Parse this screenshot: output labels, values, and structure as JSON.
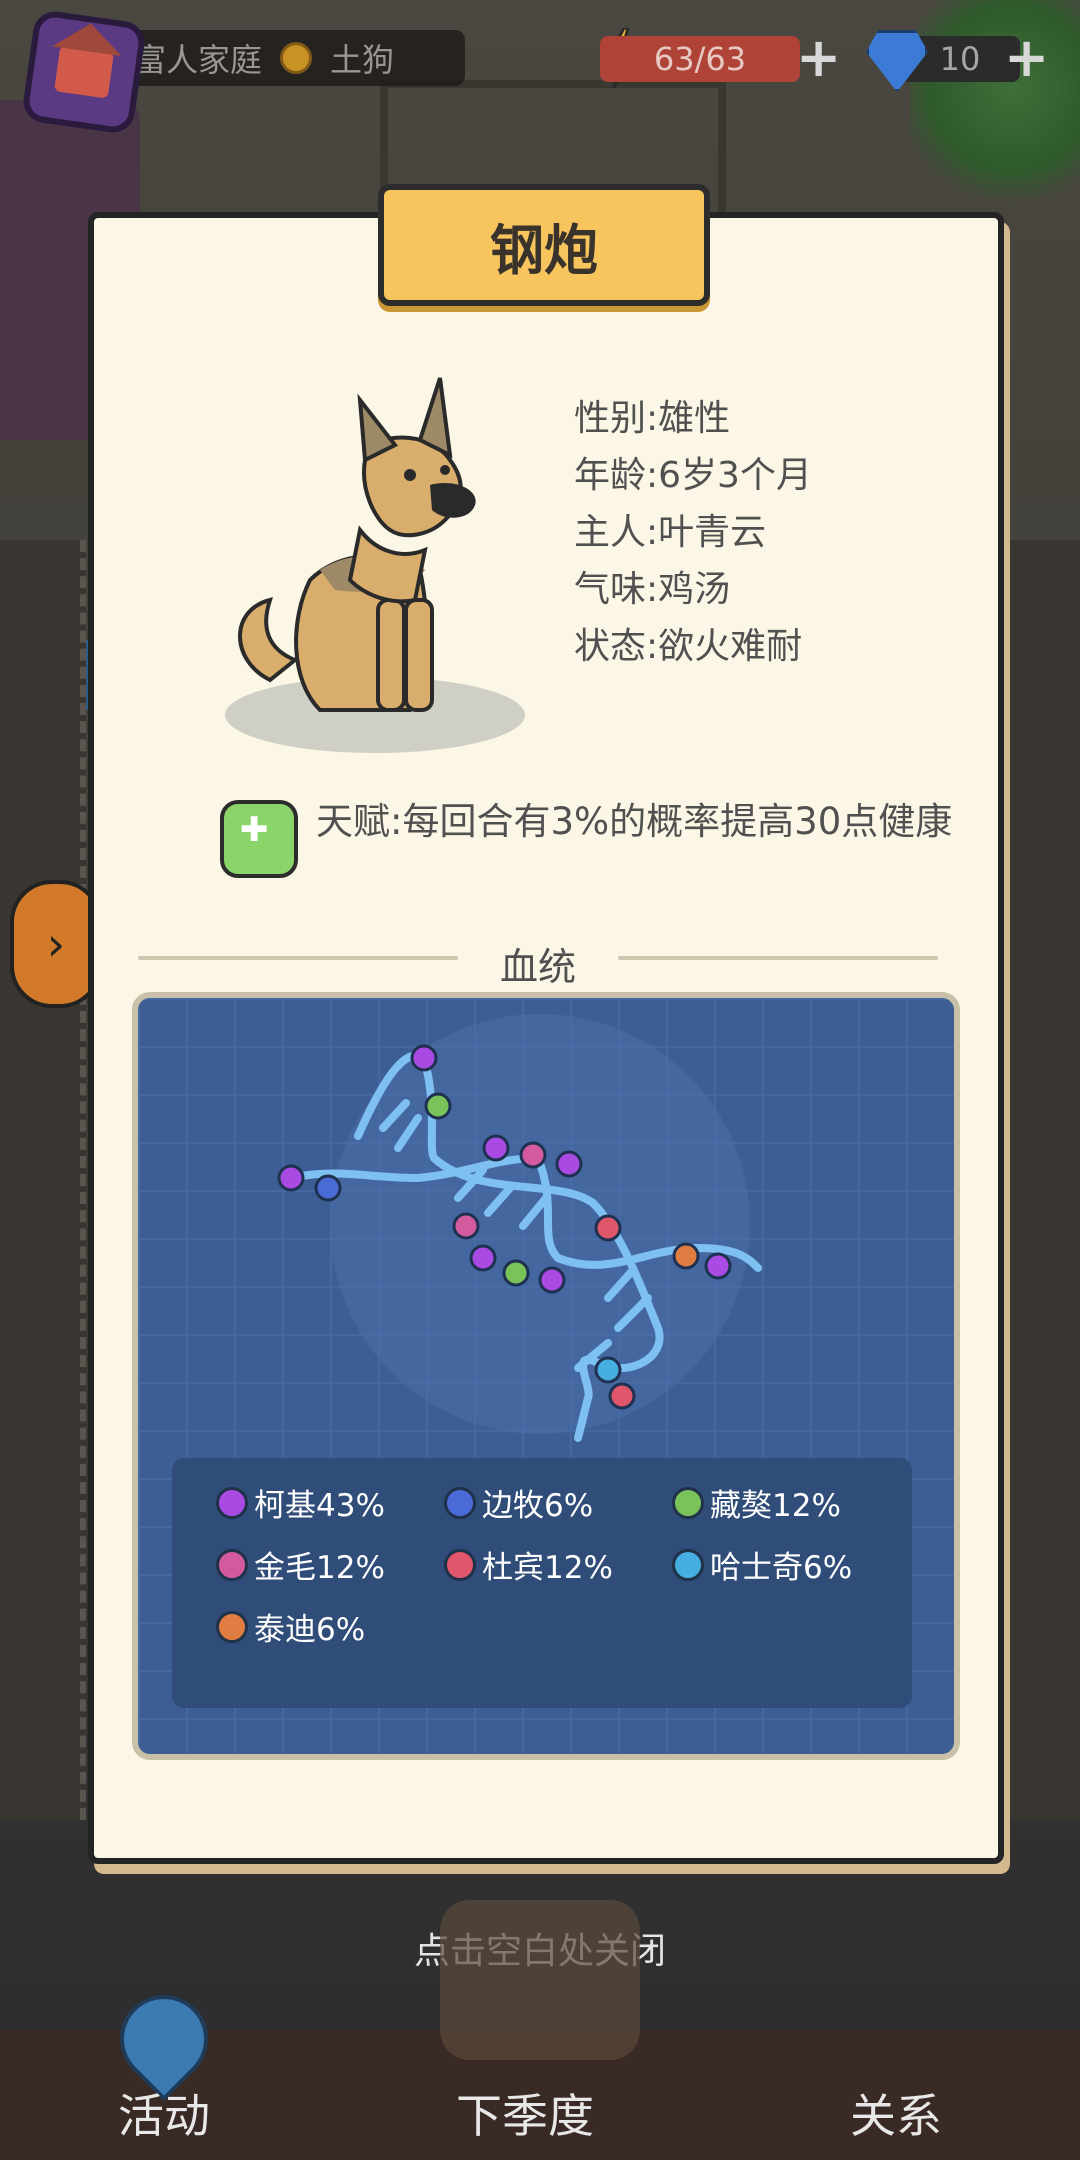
{
  "hud": {
    "family_label": "富人家庭",
    "rank_label": "土狗",
    "energy": "63/63",
    "gems": "10",
    "plus_icon": "plus-icon"
  },
  "dog": {
    "name": "钢炮",
    "info": [
      "性别:雄性",
      "年龄:6岁3个月",
      "主人:叶青云",
      "气味:鸡汤",
      "状态:欲火难耐"
    ],
    "talent": "天赋:每回合有3%的概率提高30点健康"
  },
  "lineage": {
    "title": "血统",
    "legend": [
      {
        "label": "柯基43%",
        "color": "#a94be2"
      },
      {
        "label": "边牧6%",
        "color": "#4a6ad6"
      },
      {
        "label": "藏獒12%",
        "color": "#7ac35a"
      },
      {
        "label": "金毛12%",
        "color": "#d45aa0"
      },
      {
        "label": "杜宾12%",
        "color": "#e0566a"
      },
      {
        "label": "哈士奇6%",
        "color": "#46aee0"
      },
      {
        "label": "泰迪6%",
        "color": "#e07d42"
      }
    ]
  },
  "ui": {
    "close_hint": "点击空白处关闭",
    "bottom": {
      "activity": "活动",
      "next_season": "下季度",
      "relations": "关系"
    }
  }
}
